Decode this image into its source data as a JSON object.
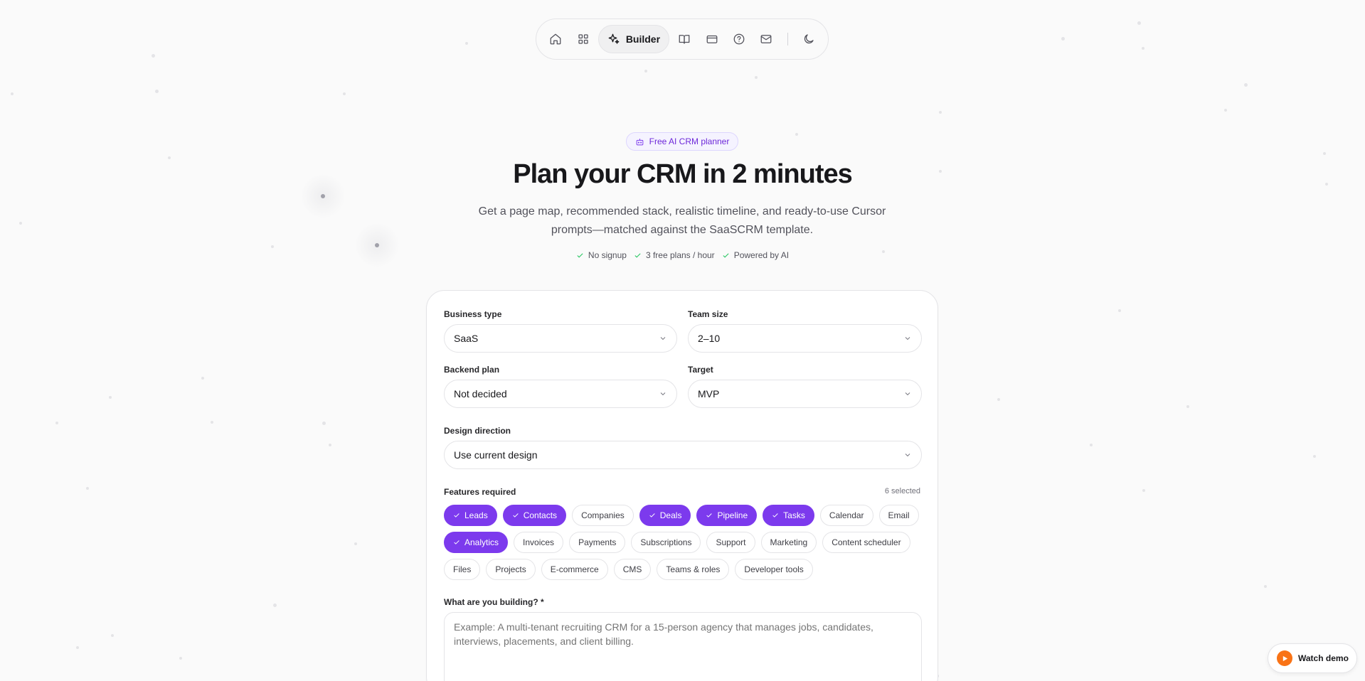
{
  "nav": {
    "icons": [
      "home-icon",
      "grid-icon",
      "sparkles-icon",
      "book-icon",
      "card-icon",
      "help-icon",
      "mail-icon",
      "moon-icon"
    ],
    "builder_label": "Builder"
  },
  "hero": {
    "badge": "Free AI CRM planner",
    "title": "Plan your CRM in 2 minutes",
    "subtitle": "Get a page map, recommended stack, realistic timeline, and ready-to-use Cursor prompts—matched against the SaaSCRM template.",
    "checks": [
      "No signup",
      "3 free plans / hour",
      "Powered by AI"
    ]
  },
  "form": {
    "business_type": {
      "label": "Business type",
      "value": "SaaS"
    },
    "team_size": {
      "label": "Team size",
      "value": "2–10"
    },
    "backend_plan": {
      "label": "Backend plan",
      "value": "Not decided"
    },
    "target": {
      "label": "Target",
      "value": "MVP"
    },
    "design_direction": {
      "label": "Design direction",
      "value": "Use current design"
    },
    "features": {
      "label": "Features required",
      "count_text": "6 selected",
      "items": [
        {
          "label": "Leads",
          "selected": true
        },
        {
          "label": "Contacts",
          "selected": true
        },
        {
          "label": "Companies",
          "selected": false
        },
        {
          "label": "Deals",
          "selected": true
        },
        {
          "label": "Pipeline",
          "selected": true
        },
        {
          "label": "Tasks",
          "selected": true
        },
        {
          "label": "Calendar",
          "selected": false
        },
        {
          "label": "Email",
          "selected": false
        },
        {
          "label": "Analytics",
          "selected": true
        },
        {
          "label": "Invoices",
          "selected": false
        },
        {
          "label": "Payments",
          "selected": false
        },
        {
          "label": "Subscriptions",
          "selected": false
        },
        {
          "label": "Support",
          "selected": false
        },
        {
          "label": "Marketing",
          "selected": false
        },
        {
          "label": "Content scheduler",
          "selected": false
        },
        {
          "label": "Files",
          "selected": false
        },
        {
          "label": "Projects",
          "selected": false
        },
        {
          "label": "E-commerce",
          "selected": false
        },
        {
          "label": "CMS",
          "selected": false
        },
        {
          "label": "Teams & roles",
          "selected": false
        },
        {
          "label": "Developer tools",
          "selected": false
        }
      ]
    },
    "building": {
      "label": "What are you building? *",
      "placeholder": "Example: A multi-tenant recruiting CRM for a 15-person agency that manages jobs, candidates, interviews, placements, and client billing.",
      "value": ""
    }
  },
  "watch_demo": {
    "label": "Watch demo"
  },
  "colors": {
    "accent": "#7c3aed",
    "check": "#22c55e",
    "play": "#f97316",
    "background": "#fafafa"
  }
}
